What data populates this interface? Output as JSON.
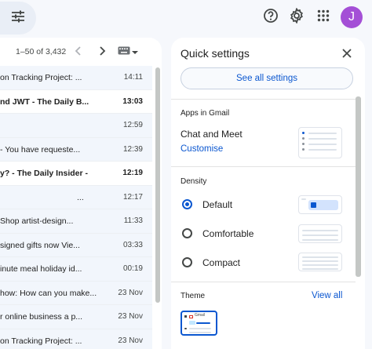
{
  "topbar": {
    "filter_icon": "tune-icon",
    "help_icon": "help-icon",
    "settings_icon": "gear-icon",
    "apps_icon": "apps-grid-icon",
    "avatar_initial": "J",
    "avatar_color": "#a44fd6"
  },
  "pager": {
    "range": "1–50 of 3,432",
    "prev_icon": "chevron-left-icon",
    "next_icon": "chevron-right-icon",
    "input_icon": "keyboard-icon"
  },
  "emails": [
    {
      "subject": "on Tracking Project: ...",
      "time": "14:11",
      "bold": false
    },
    {
      "subject": "nd JWT - The Daily B...",
      "time": "13:03",
      "bold": true
    },
    {
      "subject": "",
      "time": "12:59",
      "bold": false
    },
    {
      "subject": "- You have requeste...",
      "time": "12:39",
      "bold": false
    },
    {
      "subject": "y? - The Daily Insider -",
      "time": "12:19",
      "bold": true
    },
    {
      "subject": "...",
      "time": "12:17",
      "bold": false
    },
    {
      "subject": "Shop artist-design...",
      "time": "11:33",
      "bold": false
    },
    {
      "subject": "signed gifts now Vie...",
      "time": "03:33",
      "bold": false
    },
    {
      "subject": "inute meal holiday id...",
      "time": "00:19",
      "bold": false
    },
    {
      "subject": "how: How can you make...",
      "time": "23 Nov",
      "bold": false
    },
    {
      "subject": "r online business a p...",
      "time": "23 Nov",
      "bold": false
    },
    {
      "subject": "on Tracking Project: ...",
      "time": "23 Nov",
      "bold": false
    }
  ],
  "quick_settings": {
    "title": "Quick settings",
    "close_icon": "close-icon",
    "see_all": "See all settings",
    "apps_section": "Apps in Gmail",
    "chat_meet": "Chat and Meet",
    "customise": "Customise",
    "density_section": "Density",
    "density_options": [
      "Default",
      "Comfortable",
      "Compact"
    ],
    "density_selected": "Default",
    "theme_section": "Theme",
    "view_all": "View all",
    "theme_thumb_text": "Gmail",
    "accent": "#0b57d0"
  }
}
